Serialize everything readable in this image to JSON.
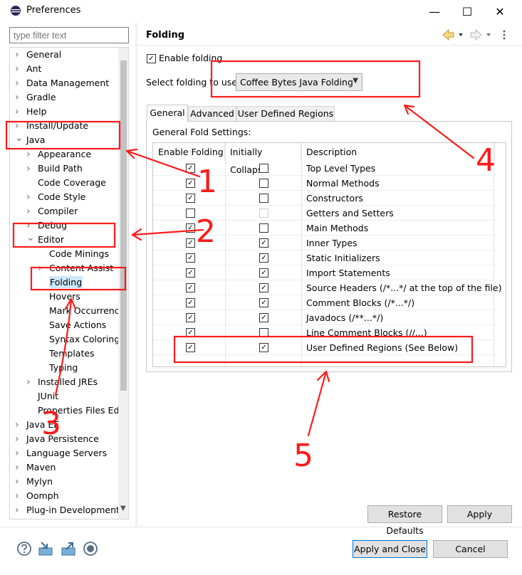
{
  "window": {
    "title": "Preferences",
    "minimize_glyph": "—",
    "maximize_glyph": "☐",
    "close_glyph": "✕",
    "app_icon": "eclipse-icon"
  },
  "filter": {
    "placeholder": "type filter text"
  },
  "tree": {
    "items": [
      {
        "label": "General",
        "level": 0,
        "state": "collapsed"
      },
      {
        "label": "Ant",
        "level": 0,
        "state": "collapsed"
      },
      {
        "label": "Data Management",
        "level": 0,
        "state": "collapsed"
      },
      {
        "label": "Gradle",
        "level": 0,
        "state": "collapsed"
      },
      {
        "label": "Help",
        "level": 0,
        "state": "collapsed"
      },
      {
        "label": "Install/Update",
        "level": 0,
        "state": "collapsed"
      },
      {
        "label": "Java",
        "level": 0,
        "state": "expanded"
      },
      {
        "label": "Appearance",
        "level": 1,
        "state": "collapsed"
      },
      {
        "label": "Build Path",
        "level": 1,
        "state": "collapsed"
      },
      {
        "label": "Code Coverage",
        "level": 1,
        "state": "leaf"
      },
      {
        "label": "Code Style",
        "level": 1,
        "state": "collapsed"
      },
      {
        "label": "Compiler",
        "level": 1,
        "state": "collapsed"
      },
      {
        "label": "Debug",
        "level": 1,
        "state": "collapsed"
      },
      {
        "label": "Editor",
        "level": 1,
        "state": "expanded"
      },
      {
        "label": "Code Minings",
        "level": 2,
        "state": "leaf"
      },
      {
        "label": "Content Assist",
        "level": 2,
        "state": "collapsed"
      },
      {
        "label": "Folding",
        "level": 2,
        "state": "leaf",
        "selected": true
      },
      {
        "label": "Hovers",
        "level": 2,
        "state": "leaf"
      },
      {
        "label": "Mark Occurrences",
        "level": 2,
        "state": "leaf"
      },
      {
        "label": "Save Actions",
        "level": 2,
        "state": "leaf"
      },
      {
        "label": "Syntax Coloring",
        "level": 2,
        "state": "leaf"
      },
      {
        "label": "Templates",
        "level": 2,
        "state": "leaf"
      },
      {
        "label": "Typing",
        "level": 2,
        "state": "leaf"
      },
      {
        "label": "Installed JREs",
        "level": 1,
        "state": "collapsed"
      },
      {
        "label": "JUnit",
        "level": 1,
        "state": "leaf"
      },
      {
        "label": "Properties Files Edit",
        "level": 1,
        "state": "leaf"
      },
      {
        "label": "Java EE",
        "level": 0,
        "state": "collapsed"
      },
      {
        "label": "Java Persistence",
        "level": 0,
        "state": "collapsed"
      },
      {
        "label": "Language Servers",
        "level": 0,
        "state": "collapsed"
      },
      {
        "label": "Maven",
        "level": 0,
        "state": "collapsed"
      },
      {
        "label": "Mylyn",
        "level": 0,
        "state": "collapsed"
      },
      {
        "label": "Oomph",
        "level": 0,
        "state": "collapsed"
      },
      {
        "label": "Plug-in Development",
        "level": 0,
        "state": "collapsed"
      }
    ]
  },
  "page": {
    "title": "Folding",
    "enable_folding": {
      "label": "Enable folding",
      "checked": true
    },
    "select_label": "Select folding to use:",
    "select_value": "Coffee Bytes Java Folding",
    "tabs": [
      {
        "label": "General",
        "active": true
      },
      {
        "label": "Advanced",
        "active": false
      },
      {
        "label": "User Defined Regions",
        "active": false
      }
    ],
    "group_label": "General Fold Settings:",
    "columns": [
      "Enable Folding",
      "Initially Collapse",
      "Description"
    ],
    "rows": [
      {
        "enable": true,
        "collapse": false,
        "collapse_disabled": false,
        "desc": "Top Level Types"
      },
      {
        "enable": true,
        "collapse": false,
        "collapse_disabled": false,
        "desc": "Normal Methods"
      },
      {
        "enable": true,
        "collapse": false,
        "collapse_disabled": false,
        "desc": "Constructors"
      },
      {
        "enable": false,
        "collapse": false,
        "collapse_disabled": true,
        "desc": "Getters and Setters"
      },
      {
        "enable": true,
        "collapse": false,
        "collapse_disabled": false,
        "desc": "Main Methods"
      },
      {
        "enable": true,
        "collapse": true,
        "collapse_disabled": false,
        "desc": "Inner Types"
      },
      {
        "enable": true,
        "collapse": true,
        "collapse_disabled": false,
        "desc": "Static Initializers"
      },
      {
        "enable": true,
        "collapse": true,
        "collapse_disabled": false,
        "desc": "Import Statements"
      },
      {
        "enable": true,
        "collapse": true,
        "collapse_disabled": false,
        "desc": "Source Headers (/*...*/ at the top of the file)"
      },
      {
        "enable": true,
        "collapse": true,
        "collapse_disabled": false,
        "desc": "Comment Blocks (/*...*/)"
      },
      {
        "enable": true,
        "collapse": true,
        "collapse_disabled": false,
        "desc": "Javadocs (/**...*/)"
      },
      {
        "enable": true,
        "collapse": false,
        "collapse_disabled": false,
        "desc": "Line Comment Blocks (//...)"
      },
      {
        "enable": true,
        "collapse": true,
        "collapse_disabled": false,
        "desc": "User Defined Regions (See Below)"
      }
    ]
  },
  "buttons": {
    "restore_defaults": "Restore Defaults",
    "apply": "Apply",
    "apply_and_close": "Apply and Close",
    "cancel": "Cancel"
  },
  "annotations": {
    "color": "#ff1a1a",
    "numbers": [
      "1",
      "2",
      "3",
      "4",
      "5"
    ]
  }
}
